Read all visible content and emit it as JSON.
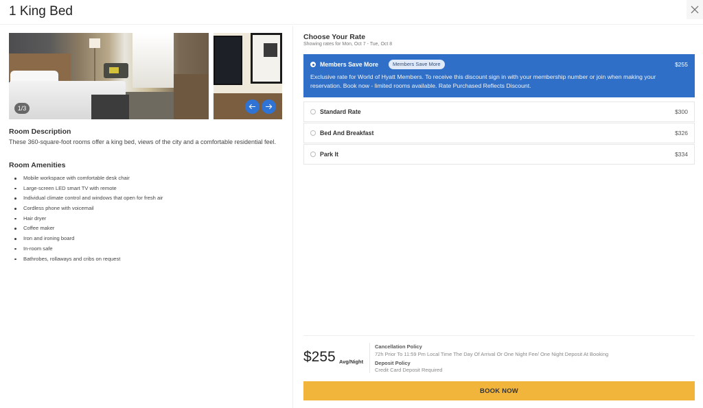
{
  "header": {
    "title": "1 King Bed",
    "close_icon": "close-icon"
  },
  "gallery": {
    "counter": "1/3",
    "prev_icon": "arrow-left-icon",
    "next_icon": "arrow-right-icon"
  },
  "room": {
    "description_title": "Room Description",
    "description": "These 360-square-foot rooms offer a king bed, views of the city and a comfortable residential feel.",
    "amenities_title": "Room Amenities",
    "amenities": [
      "Mobile workspace with comfortable desk chair",
      "Large-screen LED smart TV with remote",
      "Individual climate control and windows that open for fresh air",
      "Cordless phone with voicemail",
      "Hair dryer",
      "Coffee maker",
      "Iron and ironing board",
      "In-room safe",
      "Bathrobes, rollaways and cribs on request"
    ]
  },
  "rates": {
    "title": "Choose Your Rate",
    "subtitle": "Showing rates for Mon, Oct 7 - Tue, Oct 8",
    "accent_color": "#2f6fc8",
    "options": [
      {
        "name": "Members Save More",
        "badge": "Members Save More",
        "price": "$255",
        "selected": true,
        "description": "Exclusive rate for World of Hyatt Members. To receive this discount sign in with your membership number or join when making your reservation. Book now - limited rooms available. Rate Purchased Reflects Discount."
      },
      {
        "name": "Standard Rate",
        "price": "$300",
        "selected": false
      },
      {
        "name": "Bed And Breakfast",
        "price": "$326",
        "selected": false
      },
      {
        "name": "Park It",
        "price": "$334",
        "selected": false
      }
    ]
  },
  "summary": {
    "price": "$255",
    "price_unit": "Avg/Night",
    "cancellation_label": "Cancellation Policy",
    "cancellation_text": "72h Prior To 11:59 Pm Local Time The Day Of Arrival Or One Night Fee/ One Night Deposit At Booking",
    "deposit_label": "Deposit Policy",
    "deposit_text": "Credit Card Deposit Required",
    "book_button": "BOOK NOW",
    "book_button_color": "#f2b53c"
  }
}
